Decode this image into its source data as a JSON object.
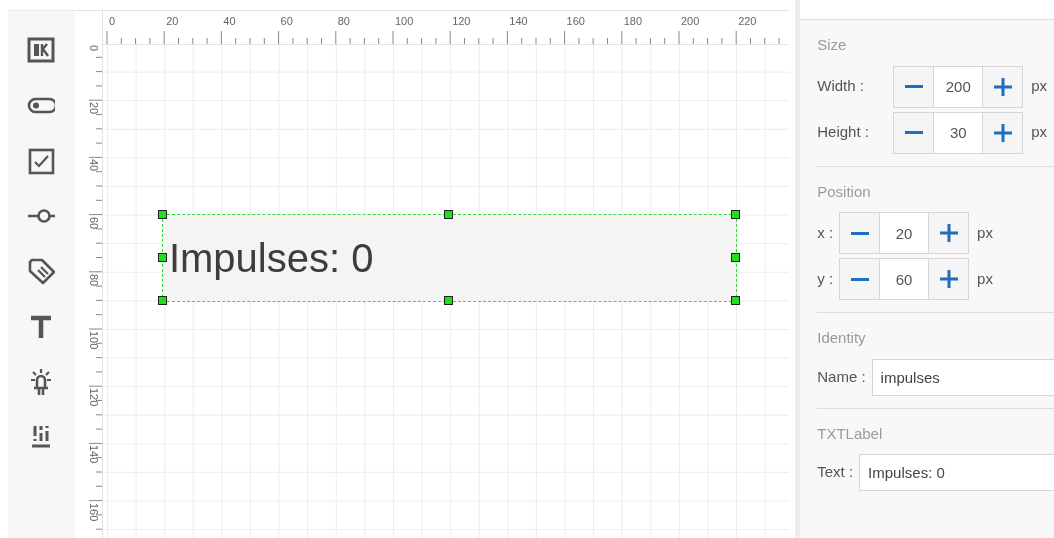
{
  "ruler_top": {
    "labels": [
      "0",
      "20",
      "40",
      "60",
      "80",
      "100",
      "120",
      "140",
      "160",
      "180",
      "200",
      "220"
    ]
  },
  "ruler_left": {
    "labels": [
      "0",
      "20",
      "40",
      "60",
      "80",
      "100",
      "120",
      "140",
      "160"
    ]
  },
  "canvas": {
    "widget": {
      "text": "Impulses: 0",
      "selected": true
    }
  },
  "properties": {
    "sections": [
      {
        "title": "Size",
        "rows": [
          {
            "kind": "stepper",
            "label": "Width :",
            "value": "200",
            "unit": "px"
          },
          {
            "kind": "stepper",
            "label": "Height :",
            "value": "30",
            "unit": "px"
          }
        ]
      },
      {
        "title": "Position",
        "rows": [
          {
            "kind": "stepper",
            "label": "x :",
            "value": "20",
            "unit": "px"
          },
          {
            "kind": "stepper",
            "label": "y :",
            "value": "60",
            "unit": "px"
          }
        ]
      },
      {
        "title": "Identity",
        "rows": [
          {
            "kind": "text",
            "label": "Name :",
            "value": "impulses"
          }
        ]
      },
      {
        "title": "TXTLabel",
        "rows": [
          {
            "kind": "text",
            "label": "Text :",
            "value": "Impulses: 0"
          }
        ]
      }
    ]
  }
}
